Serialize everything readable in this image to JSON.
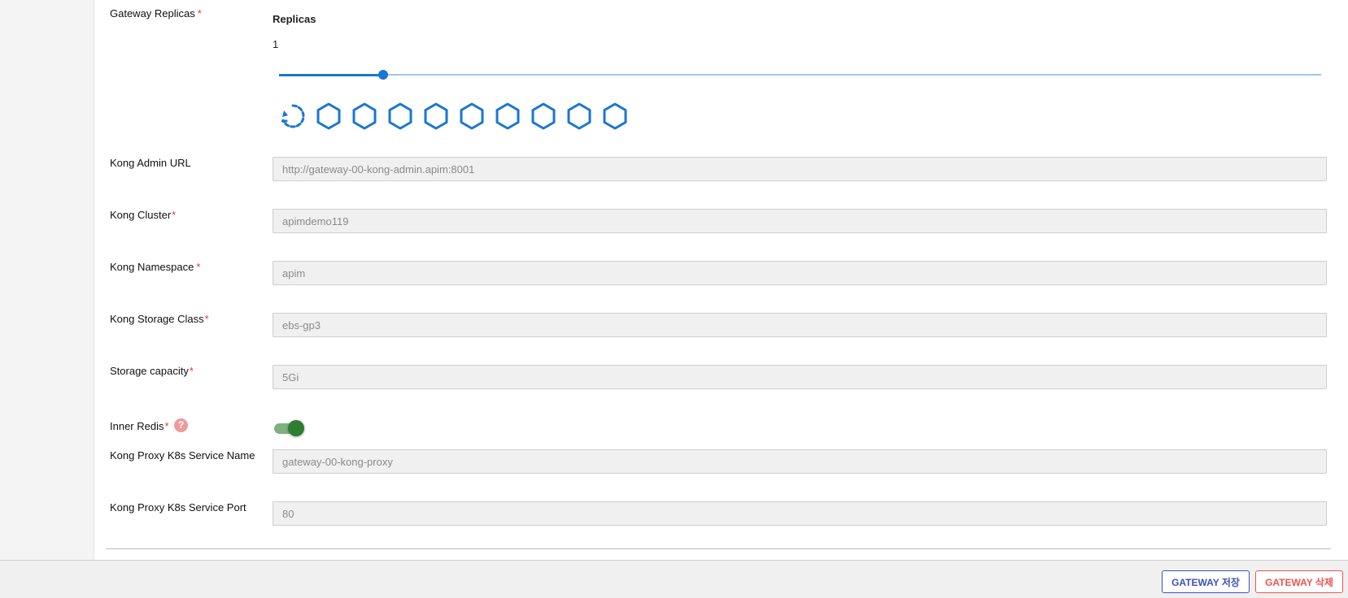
{
  "form": {
    "gateway_replicas": {
      "label": "Gateway Replicas",
      "required_mark": "*"
    },
    "replicas": {
      "title": "Replicas",
      "value": "1",
      "slider_fraction": 0.1
    },
    "replica_icons": {
      "loading": "refresh-spinner-icon",
      "pods": [
        "hexagon-icon",
        "hexagon-icon",
        "hexagon-icon",
        "hexagon-icon",
        "hexagon-icon",
        "hexagon-icon",
        "hexagon-icon",
        "hexagon-icon",
        "hexagon-icon"
      ]
    },
    "kong_admin_url": {
      "label": "Kong Admin URL",
      "value": "http://gateway-00-kong-admin.apim:8001"
    },
    "kong_cluster": {
      "label": "Kong Cluster",
      "required_mark": "*",
      "value": "apimdemo119"
    },
    "kong_namespace": {
      "label": "Kong Namespace",
      "required_mark": "*",
      "value": "apim"
    },
    "kong_storage_class": {
      "label": "Kong Storage Class",
      "required_mark": "*",
      "value": "ebs-gp3"
    },
    "storage_capacity": {
      "label": "Storage capacity",
      "required_mark": "*",
      "value": "5Gi"
    },
    "inner_redis": {
      "label": "Inner Redis",
      "required_mark": "*",
      "help_icon": "question-icon",
      "enabled": true
    },
    "kong_proxy_service_name": {
      "label": "Kong Proxy K8s Service Name",
      "value": "gateway-00-kong-proxy"
    },
    "kong_proxy_service_port": {
      "label": "Kong Proxy K8s Service Port",
      "value": "80"
    }
  },
  "actions": {
    "save_label": "GATEWAY 저장",
    "delete_label": "GATEWAY 삭제"
  },
  "colors": {
    "accent_blue": "#1976d2",
    "toggle_green": "#2e7d32",
    "required_red": "#e53935",
    "save_border": "#3f51b5",
    "delete_border": "#ef5350"
  }
}
